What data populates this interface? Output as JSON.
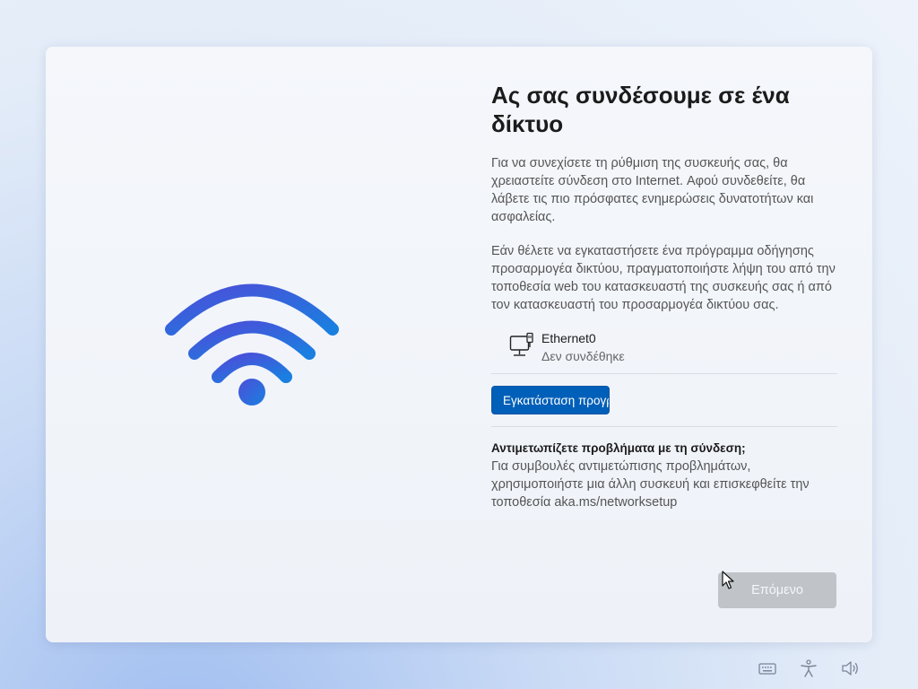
{
  "page": {
    "title": "Ας σας συνδέσουμε σε ένα δίκτυο",
    "paragraph1": "Για να συνεχίσετε τη ρύθμιση της συσκευής σας, θα χρειαστείτε σύνδεση στο Internet. Αφού συνδεθείτε, θα λάβετε τις πιο πρόσφατες ενημερώσεις δυνατοτήτων και ασφαλείας.",
    "paragraph2": "Εάν θέλετε να εγκαταστήσετε ένα πρόγραμμα οδήγησης προσαρμογέα δικτύου, πραγματοποιήστε λήψη του από την τοποθεσία web του κατασκευαστή της συσκευής σας ή από τον κατασκευαστή του προσαρμογέα δικτύου σας."
  },
  "network": {
    "name": "Ethernet0",
    "status": "Δεν συνδέθηκε",
    "icon": "ethernet-monitor-icon"
  },
  "buttons": {
    "install_label": "Εγκατάσταση προγράμματος οδήγησης",
    "next_label": "Επόμενο"
  },
  "troubleshoot": {
    "heading": "Αντιμετωπίζετε προβλήματα με τη σύνδεση;",
    "text": "Για συμβουλές αντιμετώπισης προβλημάτων, χρησιμοποιήστε μια άλλη συσκευή και επισκεφθείτε την τοποθεσία aka.ms/networksetup"
  },
  "tray": {
    "icons": [
      "keyboard-icon",
      "accessibility-icon",
      "volume-icon"
    ]
  },
  "colors": {
    "accent": "#005fb8",
    "wifi_gradient_start": "#4b4fd9",
    "wifi_gradient_end": "#1a7fe0",
    "disabled_button": "#c0c4c9"
  }
}
